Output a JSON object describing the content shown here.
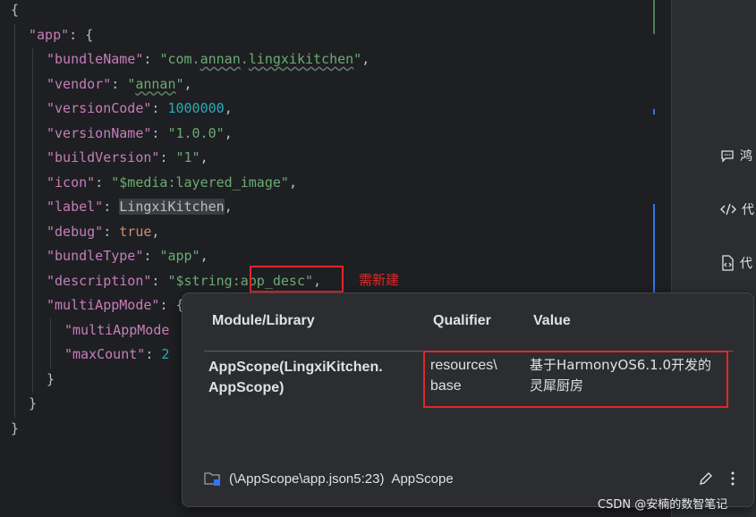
{
  "editor": {
    "lines": [
      {
        "i": 0,
        "parts": [
          [
            "p",
            "{"
          ]
        ]
      },
      {
        "i": 1,
        "parts": [
          [
            "k",
            "\"app\""
          ],
          [
            "p",
            ": {"
          ]
        ]
      },
      {
        "i": 2,
        "parts": [
          [
            "k",
            "\"bundleName\""
          ],
          [
            "p",
            ": "
          ],
          [
            "s",
            "\"com."
          ],
          [
            "su",
            "annan"
          ],
          [
            "s",
            "."
          ],
          [
            "su",
            "lingxikitchen"
          ],
          [
            "s",
            "\""
          ],
          [
            "p",
            ","
          ]
        ]
      },
      {
        "i": 2,
        "parts": [
          [
            "k",
            "\"vendor\""
          ],
          [
            "p",
            ": "
          ],
          [
            "s",
            "\""
          ],
          [
            "su",
            "annan"
          ],
          [
            "s",
            "\""
          ],
          [
            "p",
            ","
          ]
        ]
      },
      {
        "i": 2,
        "parts": [
          [
            "k",
            "\"versionCode\""
          ],
          [
            "p",
            ": "
          ],
          [
            "n",
            "1000000"
          ],
          [
            "p",
            ","
          ]
        ]
      },
      {
        "i": 2,
        "parts": [
          [
            "k",
            "\"versionName\""
          ],
          [
            "p",
            ": "
          ],
          [
            "s",
            "\"1.0.0\""
          ],
          [
            "p",
            ","
          ]
        ]
      },
      {
        "i": 2,
        "parts": [
          [
            "k",
            "\"buildVersion\""
          ],
          [
            "p",
            ": "
          ],
          [
            "s",
            "\"1\""
          ],
          [
            "p",
            ","
          ]
        ]
      },
      {
        "i": 2,
        "parts": [
          [
            "k",
            "\"icon\""
          ],
          [
            "p",
            ": "
          ],
          [
            "s",
            "\"$media:layered_image\""
          ],
          [
            "p",
            ","
          ]
        ]
      },
      {
        "i": 2,
        "parts": [
          [
            "k",
            "\"label\""
          ],
          [
            "p",
            ": "
          ],
          [
            "ph",
            "LingxiKitchen"
          ],
          [
            "p",
            ","
          ]
        ]
      },
      {
        "i": 2,
        "parts": [
          [
            "k",
            "\"debug\""
          ],
          [
            "p",
            ": "
          ],
          [
            "b",
            "true"
          ],
          [
            "p",
            ","
          ]
        ]
      },
      {
        "i": 2,
        "parts": [
          [
            "k",
            "\"bundleType\""
          ],
          [
            "p",
            ": "
          ],
          [
            "s",
            "\"app\""
          ],
          [
            "p",
            ","
          ]
        ]
      },
      {
        "i": 2,
        "parts": [
          [
            "k",
            "\"description\""
          ],
          [
            "p",
            ": "
          ],
          [
            "s",
            "\"$string:app_desc\""
          ],
          [
            "p",
            ","
          ]
        ]
      },
      {
        "i": 2,
        "parts": [
          [
            "k",
            "\"multiAppMode\""
          ],
          [
            "p",
            ": {"
          ]
        ]
      },
      {
        "i": 3,
        "parts": [
          [
            "k",
            "\"multiAppMode"
          ]
        ]
      },
      {
        "i": 3,
        "parts": [
          [
            "k",
            "\"maxCount\""
          ],
          [
            "p",
            ": "
          ],
          [
            "n",
            "2"
          ]
        ]
      },
      {
        "i": 2,
        "parts": [
          [
            "p",
            "}"
          ]
        ]
      },
      {
        "i": 1,
        "parts": [
          [
            "p",
            "}"
          ]
        ]
      },
      {
        "i": 0,
        "parts": [
          [
            "p",
            "}"
          ]
        ]
      }
    ]
  },
  "annotation": "需新建",
  "side_panel": {
    "items": [
      {
        "label": "鸿",
        "icon": "chat-icon"
      },
      {
        "label": "代",
        "icon": "code-icon"
      },
      {
        "label": "代",
        "icon": "document-icon"
      }
    ]
  },
  "popup": {
    "headers": {
      "module": "Module/Library",
      "qualifier": "Qualifier",
      "value": "Value"
    },
    "row": {
      "module_line1": "AppScope(LingxiKitchen.",
      "module_line2": "AppScope)",
      "qualifier_line1": "resources\\",
      "qualifier_line2": "base",
      "value_line1": "基于HarmonyOS6.1.0开发的",
      "value_line2": "灵犀厨房"
    },
    "footer_path": "(\\AppScope\\app.json5:23)",
    "footer_module": "AppScope"
  },
  "watermark": "CSDN @安楠的数智笔记",
  "colors": {
    "accent_red": "#e0282a",
    "key": "#c77dbb",
    "string": "#6aab73",
    "number": "#2aacb8",
    "keyword": "#cf8e6d"
  }
}
